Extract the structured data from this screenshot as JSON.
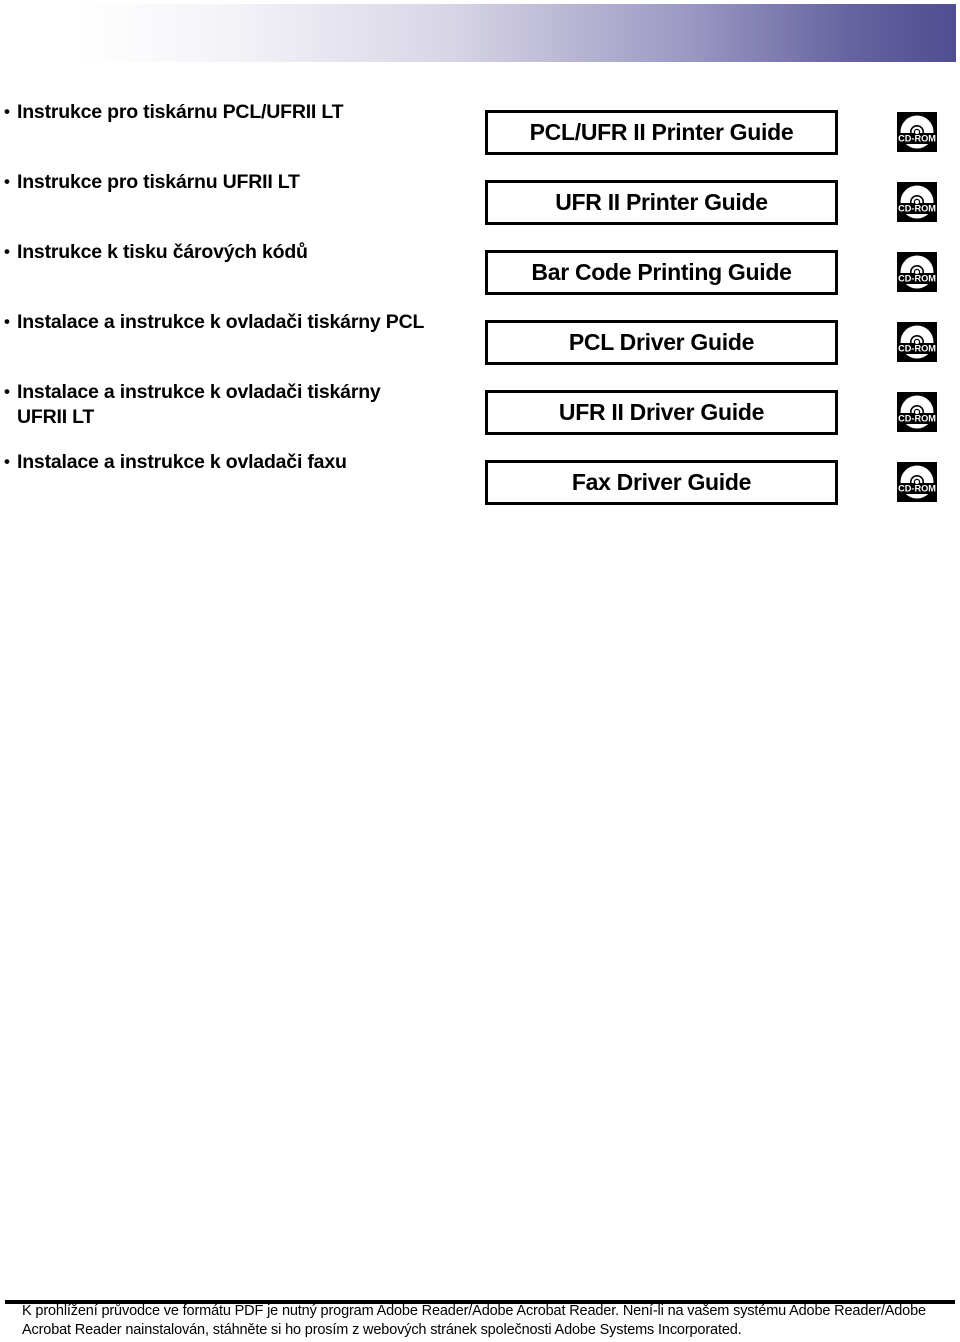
{
  "page": {
    "language": "cs",
    "banner": {
      "name": "header-gradient-banner",
      "gradient_from": "#ffffff",
      "gradient_to": "#504d91"
    }
  },
  "rows": [
    {
      "description_lines": [
        "Instrukce pro tiskárnu PCL/UFRII LT"
      ],
      "guide_label": "PCL/UFR II Printer Guide",
      "media_icon": "cd-rom-icon",
      "media_label": "CD-ROM"
    },
    {
      "description_lines": [
        "Instrukce pro tiskárnu UFRII LT"
      ],
      "guide_label": "UFR II Printer Guide",
      "media_icon": "cd-rom-icon",
      "media_label": "CD-ROM"
    },
    {
      "description_lines": [
        "Instrukce k tisku čárových kódů"
      ],
      "guide_label": "Bar Code Printing Guide",
      "media_icon": "cd-rom-icon",
      "media_label": "CD-ROM"
    },
    {
      "description_lines": [
        "Instalace a instrukce k ovladači tiskárny PCL"
      ],
      "guide_label": "PCL Driver Guide",
      "media_icon": "cd-rom-icon",
      "media_label": "CD-ROM"
    },
    {
      "description_lines": [
        "Instalace a instrukce k ovladači tiskárny",
        "UFRII LT"
      ],
      "guide_label": "UFR II Driver Guide",
      "media_icon": "cd-rom-icon",
      "media_label": "CD-ROM"
    },
    {
      "description_lines": [
        "Instalace a instrukce k ovladači faxu"
      ],
      "guide_label": "Fax Driver Guide",
      "media_icon": "cd-rom-icon",
      "media_label": "CD-ROM"
    }
  ],
  "footer": {
    "lines": [
      "K prohlížení průvodce ve formátu PDF je nutný program Adobe Reader/Adobe Acrobat Reader. Není-li na vašem systému Adobe Reader/Adobe",
      "Acrobat Reader nainstalován, stáhněte si ho prosím z webových stránek společnosti Adobe Systems Incorporated."
    ]
  }
}
